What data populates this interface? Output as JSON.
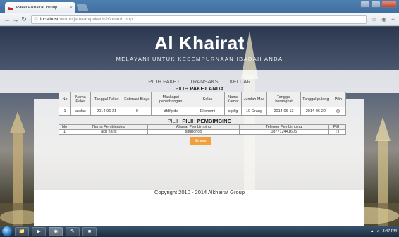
{
  "browser": {
    "tab_title": "Paket Alkhairat Group",
    "tab_close": "×",
    "url_host": "localhost",
    "url_path": "/umroh/jamaah/paket%20umroh.php"
  },
  "header": {
    "title": "Al Khairat",
    "tagline": "MELAYANI UNTUK KESEMPURNAAN IBADAH ANDA"
  },
  "nav": {
    "items": [
      "PILIH PAKET",
      "TRANSAKSI",
      "KELUAR"
    ]
  },
  "paket_section": {
    "title_prefix": "PILIH",
    "title_bold": "PAKET ANDA",
    "headers": [
      "No",
      "Nama Paket",
      "Tanggal Paket",
      "Estimasi Biaya",
      "Maskapai penerbangan",
      "Kelas",
      "Nama Kamar",
      "Jumlah Max",
      "Tanggal berangkat",
      "Tanggal pulang",
      "Pilih"
    ],
    "rows": [
      [
        "1",
        "asdas",
        "2014-06-21",
        "0",
        "dfdfgfds",
        "Ekonomi",
        "sgdfg",
        "10 Orang",
        "2014-06-13",
        "2014-06-20"
      ]
    ]
  },
  "pembimbing_section": {
    "title_prefix": "PILIH",
    "title_bold": "PILIH PEMBIMBING",
    "headers": [
      "No",
      "Nama Pembimbing",
      "Alamat Pembimbing",
      "Telepon Pembimbing",
      "Pilih"
    ],
    "rows": [
      [
        "1",
        "ach haris",
        "situbondo",
        "087712441605"
      ]
    ]
  },
  "submit_label": "Simpan",
  "footer_text": "Copyright 2010 - 2014 Alkhairat Group",
  "taskbar": {
    "clock": "3:47 PM"
  },
  "colors": {
    "accent_button": "#f29f3e",
    "header_text": "#ffffff"
  }
}
